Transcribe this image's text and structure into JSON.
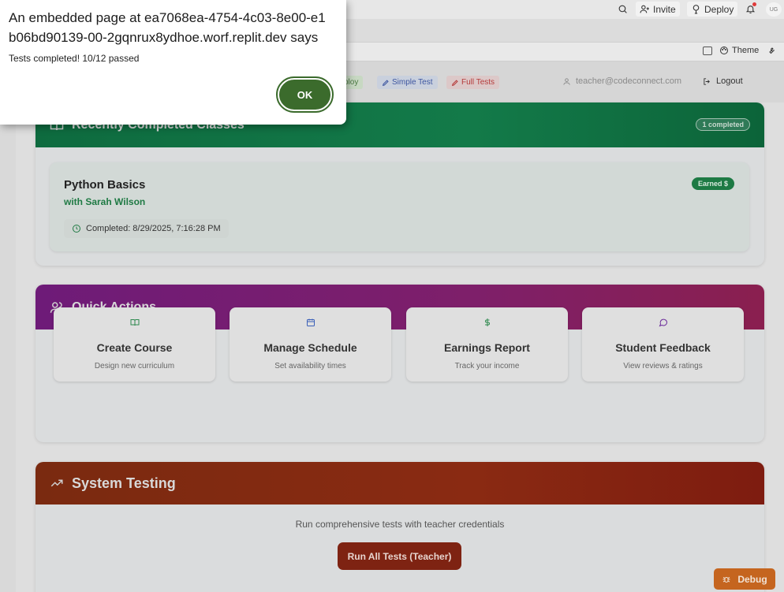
{
  "ide": {
    "invite_label": "Invite",
    "deploy_label": "Deploy",
    "avatar_initials": "UG",
    "theme_label": "Theme"
  },
  "navbar": {
    "deploy_pill": "ploy",
    "simple_test": "Simple Test",
    "full_tests": "Full Tests",
    "email": "teacher@codeconnect.com",
    "logout": "Logout"
  },
  "recent": {
    "title": "Recently Completed Classes",
    "count_badge": "1 completed",
    "item": {
      "course": "Python Basics",
      "teacher": "with Sarah Wilson",
      "completed": "Completed: 8/29/2025, 7:16:28 PM",
      "badge": "Earned $"
    }
  },
  "quick_actions": {
    "title": "Quick Actions",
    "items": [
      {
        "title": "Create Course",
        "subtitle": "Design new curriculum",
        "icon": "book-icon"
      },
      {
        "title": "Manage Schedule",
        "subtitle": "Set availability times",
        "icon": "calendar-icon"
      },
      {
        "title": "Earnings Report",
        "subtitle": "Track your income",
        "icon": "dollar-icon"
      },
      {
        "title": "Student Feedback",
        "subtitle": "View reviews & ratings",
        "icon": "message-icon"
      }
    ]
  },
  "system_testing": {
    "title": "System Testing",
    "description": "Run comprehensive tests with teacher credentials",
    "button": "Run All Tests (Teacher)"
  },
  "debug_label": "Debug",
  "dialog": {
    "heading": "An embedded page at ea7068ea-4754-4c03-8e00-e1b06bd90139-00-2gqnrux8ydhoe.worf.replit.dev says",
    "message": "Tests completed! 10/12 passed",
    "ok_label": "OK"
  },
  "colors": {
    "green_header": "#0e6b3f",
    "purple_header": "#6e1b78",
    "orange_header": "#7a2a10",
    "ok_button": "#3b6b2c",
    "debug_button": "#c5651f"
  }
}
